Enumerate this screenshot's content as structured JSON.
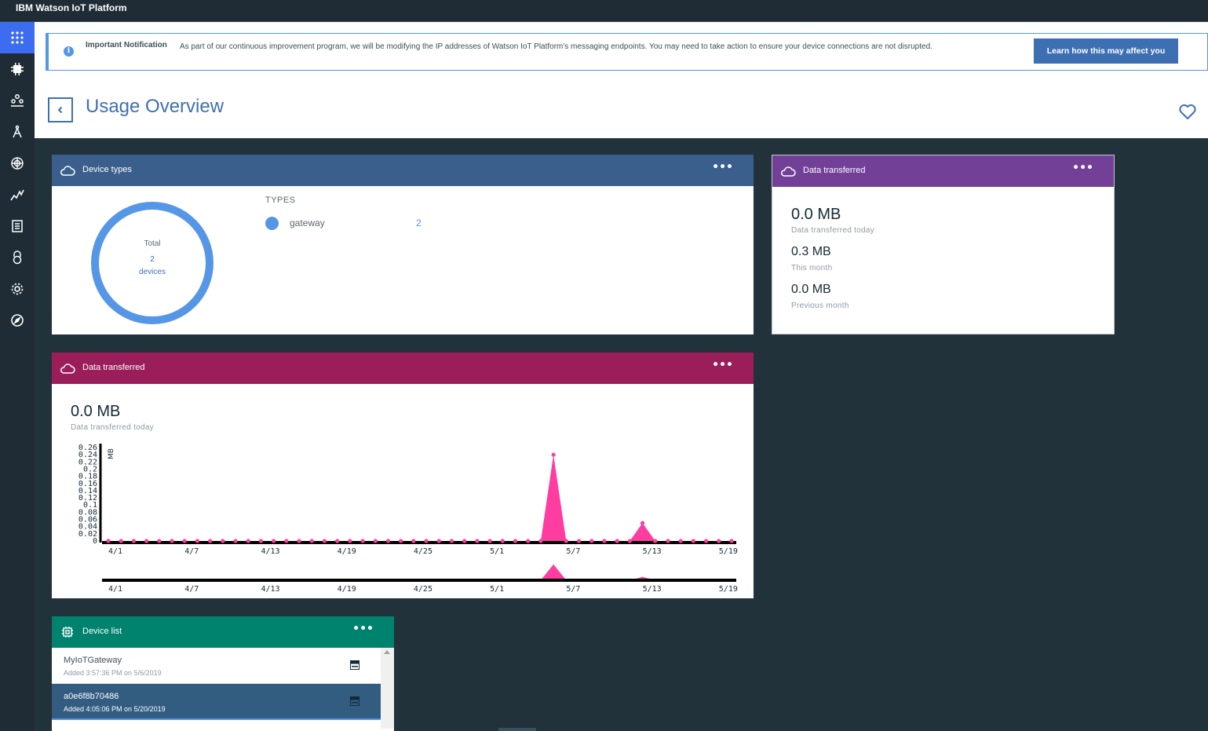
{
  "app": {
    "title": "IBM Watson IoT Platform"
  },
  "sidebar": {
    "items": [
      {
        "icon": "apps-grid-icon",
        "active": true
      },
      {
        "icon": "chip-icon",
        "active": false
      },
      {
        "icon": "members-icon",
        "active": false
      },
      {
        "icon": "compass-draw-icon",
        "active": false
      },
      {
        "icon": "analytics-icon",
        "active": false
      },
      {
        "icon": "usage-chart-icon",
        "active": false
      },
      {
        "icon": "document-icon",
        "active": false
      },
      {
        "icon": "security-icon",
        "active": false
      },
      {
        "icon": "settings-gear-icon",
        "active": false
      },
      {
        "icon": "explore-compass-icon",
        "active": false
      }
    ]
  },
  "notification": {
    "title": "Important Notification",
    "text": "As part of our continuous improvement program, we will be modifying the IP addresses of Watson IoT Platform's messaging endpoints. You may need to take action to ensure your device connections are not disrupted.",
    "button": "Learn how this may affect you"
  },
  "page": {
    "title": "Usage Overview"
  },
  "device_types_card": {
    "title": "Device types",
    "more": "•••",
    "total_label": "Total",
    "total_value": "2",
    "total_unit": "devices",
    "types_heading": "TYPES",
    "types": [
      {
        "name": "gateway",
        "count": "2"
      }
    ]
  },
  "data_summary_card": {
    "title": "Data transferred",
    "more": "•••",
    "today_value": "0.0 MB",
    "today_label": "Data transferred today",
    "month_value": "0.3 MB",
    "month_label": "This month",
    "prev_value": "0.0 MB",
    "prev_label": "Previous month"
  },
  "data_chart_card": {
    "title": "Data transferred",
    "more": "•••",
    "today_value": "0.0 MB",
    "today_label": "Data transferred today"
  },
  "device_list_card": {
    "title": "Device list",
    "more": "•••",
    "devices": [
      {
        "name": "MyIoTGateway",
        "added": "Added 3:57:36 PM on 5/6/2019",
        "selected": false
      },
      {
        "name": "a0e6f8b70486",
        "added": "Added 4:05:06 PM on 5/20/2019",
        "selected": true
      }
    ]
  },
  "colors": {
    "device_types_header": "#3b5f8c",
    "data_summary_header": "#734098",
    "data_chart_header": "#9b1e5a",
    "device_list_header": "#00836e",
    "chart_series": "#ff3ca0",
    "donut": "#5596e6"
  },
  "chart_data": {
    "type": "area",
    "ylabel": "MB",
    "yticks": [
      "0.26",
      "0.24",
      "0.22",
      "0.2",
      "0.18",
      "0.16",
      "0.14",
      "0.12",
      "0.1",
      "0.08",
      "0.06",
      "0.04",
      "0.02",
      "0"
    ],
    "ylim": [
      0,
      0.26
    ],
    "xticks": [
      "4/1",
      "4/7",
      "4/13",
      "4/19",
      "4/25",
      "5/1",
      "5/7",
      "5/13",
      "5/19"
    ],
    "x_start": "4/1",
    "x_end": "5/20",
    "series": [
      {
        "values": [
          0,
          0,
          0,
          0,
          0,
          0,
          0,
          0,
          0,
          0,
          0,
          0,
          0,
          0,
          0,
          0,
          0,
          0,
          0,
          0,
          0,
          0,
          0,
          0,
          0,
          0,
          0,
          0,
          0,
          0,
          0,
          0,
          0,
          0,
          0,
          0.24,
          0,
          0,
          0,
          0,
          0,
          0,
          0.05,
          0,
          0,
          0,
          0,
          0,
          0,
          0
        ]
      }
    ]
  }
}
